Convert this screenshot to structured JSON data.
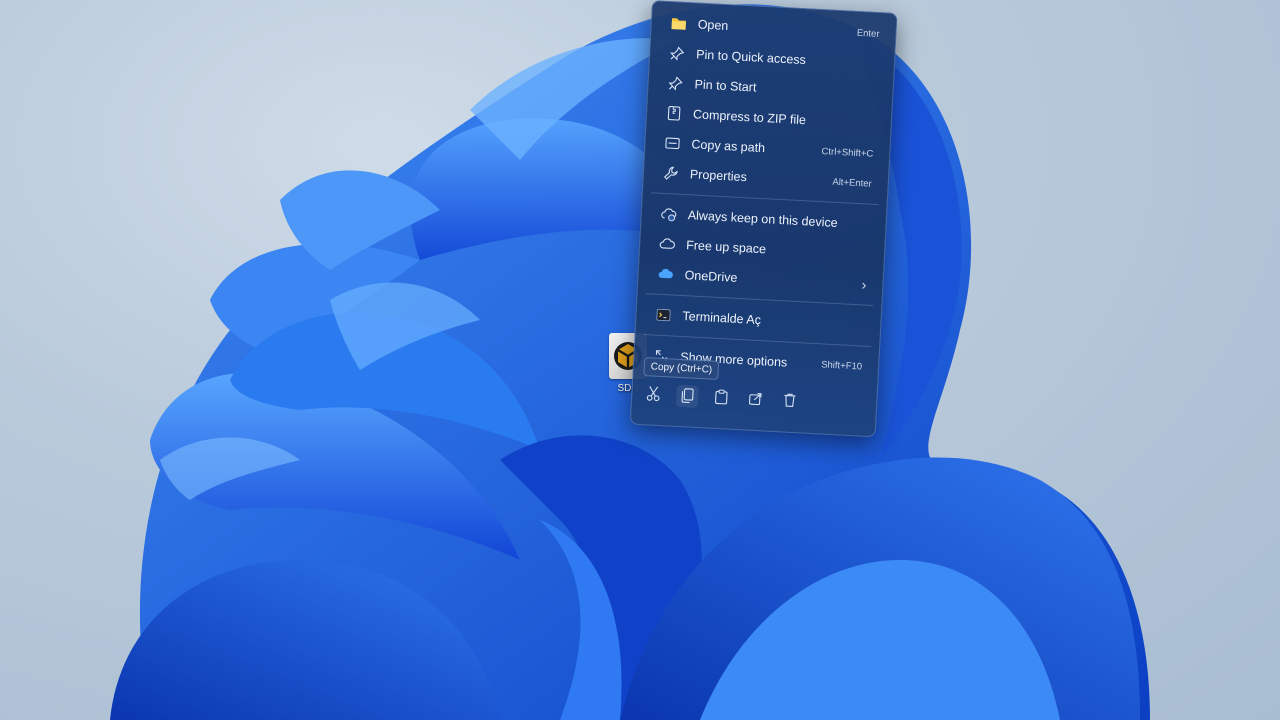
{
  "desktop": {
    "icon": {
      "label": "SDN",
      "icon": "sdn-app-icon"
    }
  },
  "context_menu": {
    "items": [
      {
        "label": "Open",
        "shortcut": "Enter",
        "icon": "folder-icon"
      },
      {
        "label": "Pin to Quick access",
        "shortcut": "",
        "icon": "pin-icon"
      },
      {
        "label": "Pin to Start",
        "shortcut": "",
        "icon": "pin-icon"
      },
      {
        "label": "Compress to ZIP file",
        "shortcut": "",
        "icon": "zip-icon"
      },
      {
        "label": "Copy as path",
        "shortcut": "Ctrl+Shift+C",
        "icon": "copy-path-icon"
      },
      {
        "label": "Properties",
        "shortcut": "Alt+Enter",
        "icon": "wrench-icon"
      }
    ],
    "onedrive_items": [
      {
        "label": "Always keep on this device",
        "icon": "cloud-check-icon"
      },
      {
        "label": "Free up space",
        "icon": "cloud-icon"
      },
      {
        "label": "OneDrive",
        "icon": "onedrive-icon"
      }
    ],
    "terminal_label": "Terminalde Aç",
    "more_options": {
      "label": "Show more options",
      "shortcut": "Shift+F10"
    },
    "tooltip": "Copy (Ctrl+C)",
    "actions": [
      {
        "name": "cut-icon"
      },
      {
        "name": "copy-icon"
      },
      {
        "name": "paste-icon"
      },
      {
        "name": "share-icon"
      },
      {
        "name": "delete-icon"
      }
    ]
  }
}
